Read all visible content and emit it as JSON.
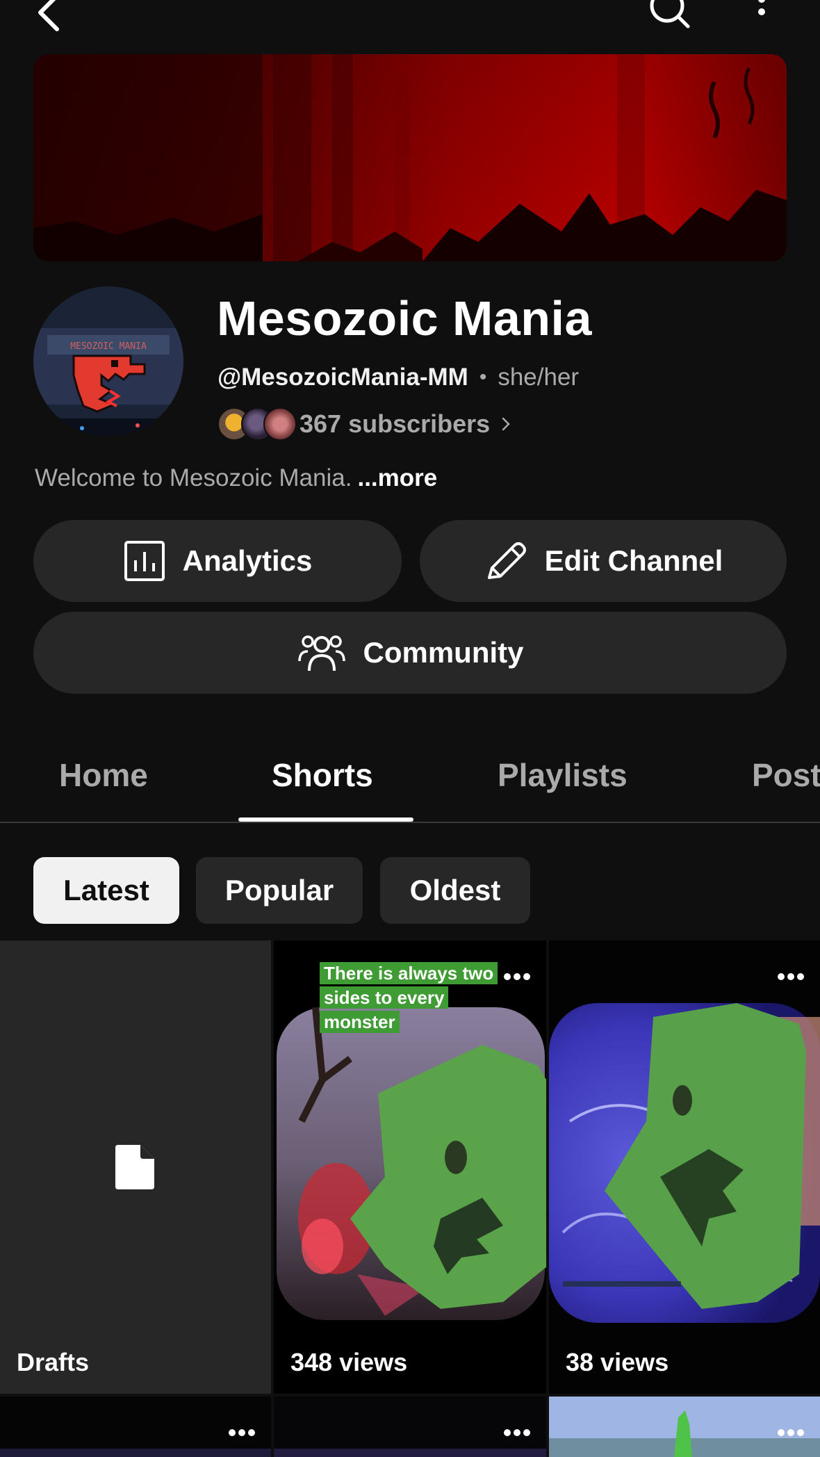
{
  "header": {
    "back_icon": "chevron-left-icon",
    "search_icon": "search-icon",
    "more_icon": "more-vertical-icon"
  },
  "channel": {
    "name": "Mesozoic Mania",
    "handle": "@MesozoicMania-MM",
    "separator": "•",
    "pronouns": "she/her",
    "subscribers": "367 subscribers",
    "description": "Welcome to Mesozoic Mania.",
    "more_link": "...more",
    "avatar_text": "MESOZOIC MANIA"
  },
  "actions": {
    "analytics_label": "Analytics",
    "edit_label": "Edit Channel",
    "community_label": "Community"
  },
  "tabs": [
    {
      "label": "Home"
    },
    {
      "label": "Shorts"
    },
    {
      "label": "Playlists"
    },
    {
      "label": "Posts"
    }
  ],
  "active_tab": "Shorts",
  "sort_chips": [
    {
      "label": "Latest"
    },
    {
      "label": "Popular"
    },
    {
      "label": "Oldest"
    }
  ],
  "selected_chip": "Latest",
  "shorts": [
    {
      "label": "Drafts"
    },
    {
      "label": "348 views",
      "caption": "There is always two sides to every monster"
    },
    {
      "label": "38 views"
    }
  ],
  "colors": {
    "background": "#0f0f0f",
    "button_bg": "#272727",
    "secondary_text": "#aaaaaa",
    "caption_bg": "#3f9b33",
    "banner_red": "#c40000"
  }
}
